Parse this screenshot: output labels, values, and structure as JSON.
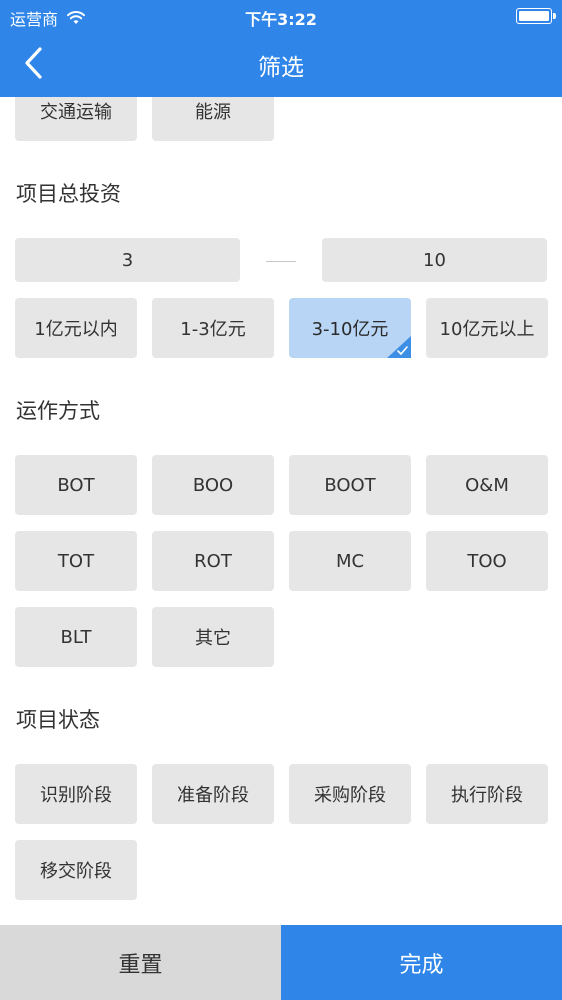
{
  "status_bar": {
    "carrier": "运营商",
    "time": "下午3:22"
  },
  "nav": {
    "title": "筛选"
  },
  "industry": {
    "items": [
      "交通运输",
      "能源"
    ]
  },
  "investment": {
    "title": "项目总投资",
    "min_value": "3",
    "max_value": "10",
    "options": [
      "1亿元以内",
      "1-3亿元",
      "3-10亿元",
      "10亿元以上"
    ],
    "selected_option": "3-10亿元"
  },
  "operation": {
    "title": "运作方式",
    "options": [
      "BOT",
      "BOO",
      "BOOT",
      "O&M",
      "TOT",
      "ROT",
      "MC",
      "TOO",
      "BLT",
      "其它"
    ]
  },
  "status": {
    "title": "项目状态",
    "options": [
      "识别阶段",
      "准备阶段",
      "采购阶段",
      "执行阶段",
      "移交阶段"
    ]
  },
  "footer": {
    "reset_label": "重置",
    "done_label": "完成"
  },
  "colors": {
    "primary": "#2f86e8",
    "button_bg": "#e6e6e6",
    "selected_bg": "#b8d5f5",
    "reset_bg": "#d9d9d9"
  }
}
